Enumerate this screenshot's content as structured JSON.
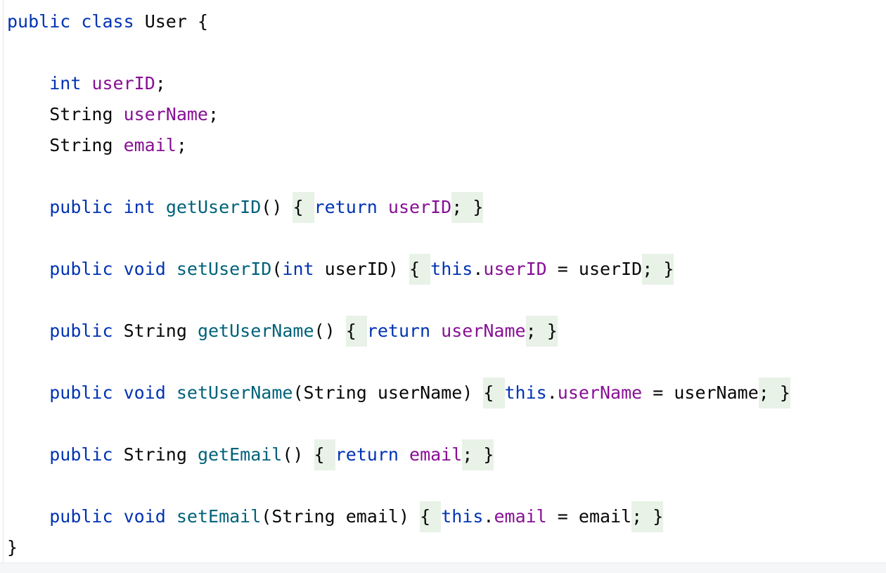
{
  "editor": {
    "lines": [
      {
        "tokens": [
          {
            "t": "public",
            "c": "kw"
          },
          {
            "t": " "
          },
          {
            "t": "class",
            "c": "kw"
          },
          {
            "t": " User {"
          }
        ]
      },
      {
        "tokens": []
      },
      {
        "tokens": [
          {
            "t": "    "
          },
          {
            "t": "int",
            "c": "kw"
          },
          {
            "t": " "
          },
          {
            "t": "userID",
            "c": "fld"
          },
          {
            "t": ";"
          }
        ]
      },
      {
        "tokens": [
          {
            "t": "    String "
          },
          {
            "t": "userName",
            "c": "fld"
          },
          {
            "t": ";"
          }
        ]
      },
      {
        "tokens": [
          {
            "t": "    String "
          },
          {
            "t": "email",
            "c": "fld"
          },
          {
            "t": ";"
          }
        ]
      },
      {
        "tokens": []
      },
      {
        "tokens": [
          {
            "t": "    "
          },
          {
            "t": "public",
            "c": "kw"
          },
          {
            "t": " "
          },
          {
            "t": "int",
            "c": "kw"
          },
          {
            "t": " "
          },
          {
            "t": "getUserID",
            "c": "fn"
          },
          {
            "t": "() "
          },
          {
            "t": "{ ",
            "h": true
          },
          {
            "t": "return",
            "c": "kw"
          },
          {
            "t": " "
          },
          {
            "t": "userID",
            "c": "fld"
          },
          {
            "t": "; ",
            "h": true
          },
          {
            "t": "}",
            "h": true
          }
        ]
      },
      {
        "tokens": []
      },
      {
        "tokens": [
          {
            "t": "    "
          },
          {
            "t": "public",
            "c": "kw"
          },
          {
            "t": " "
          },
          {
            "t": "void",
            "c": "kw"
          },
          {
            "t": " "
          },
          {
            "t": "setUserID",
            "c": "fn"
          },
          {
            "t": "("
          },
          {
            "t": "int",
            "c": "kw"
          },
          {
            "t": " userID) "
          },
          {
            "t": "{ ",
            "h": true
          },
          {
            "t": "this",
            "c": "kw"
          },
          {
            "t": "."
          },
          {
            "t": "userID",
            "c": "fld"
          },
          {
            "t": " = userID"
          },
          {
            "t": "; ",
            "h": true
          },
          {
            "t": "}",
            "h": true
          }
        ]
      },
      {
        "tokens": []
      },
      {
        "tokens": [
          {
            "t": "    "
          },
          {
            "t": "public",
            "c": "kw"
          },
          {
            "t": " String "
          },
          {
            "t": "getUserName",
            "c": "fn"
          },
          {
            "t": "() "
          },
          {
            "t": "{ ",
            "h": true
          },
          {
            "t": "return",
            "c": "kw"
          },
          {
            "t": " "
          },
          {
            "t": "userName",
            "c": "fld"
          },
          {
            "t": "; ",
            "h": true
          },
          {
            "t": "}",
            "h": true
          }
        ]
      },
      {
        "tokens": []
      },
      {
        "tokens": [
          {
            "t": "    "
          },
          {
            "t": "public",
            "c": "kw"
          },
          {
            "t": " "
          },
          {
            "t": "void",
            "c": "kw"
          },
          {
            "t": " "
          },
          {
            "t": "setUserName",
            "c": "fn"
          },
          {
            "t": "(String userName) "
          },
          {
            "t": "{ ",
            "h": true
          },
          {
            "t": "this",
            "c": "kw"
          },
          {
            "t": "."
          },
          {
            "t": "userName",
            "c": "fld"
          },
          {
            "t": " = userName"
          },
          {
            "t": "; ",
            "h": true
          },
          {
            "t": "}",
            "h": true
          }
        ]
      },
      {
        "tokens": []
      },
      {
        "tokens": [
          {
            "t": "    "
          },
          {
            "t": "public",
            "c": "kw"
          },
          {
            "t": " String "
          },
          {
            "t": "getEmail",
            "c": "fn"
          },
          {
            "t": "() "
          },
          {
            "t": "{ ",
            "h": true
          },
          {
            "t": "return",
            "c": "kw"
          },
          {
            "t": " "
          },
          {
            "t": "email",
            "c": "fld"
          },
          {
            "t": "; ",
            "h": true
          },
          {
            "t": "}",
            "h": true
          }
        ]
      },
      {
        "tokens": []
      },
      {
        "tokens": [
          {
            "t": "    "
          },
          {
            "t": "public",
            "c": "kw"
          },
          {
            "t": " "
          },
          {
            "t": "void",
            "c": "kw"
          },
          {
            "t": " "
          },
          {
            "t": "setEmail",
            "c": "fn"
          },
          {
            "t": "(String email) "
          },
          {
            "t": "{ ",
            "h": true
          },
          {
            "t": "this",
            "c": "kw"
          },
          {
            "t": "."
          },
          {
            "t": "email",
            "c": "fld"
          },
          {
            "t": " = email"
          },
          {
            "t": "; ",
            "h": true
          },
          {
            "t": "}",
            "h": true
          }
        ]
      },
      {
        "tokens": [
          {
            "t": "}"
          }
        ]
      }
    ]
  },
  "colors": {
    "keyword": "#0033b3",
    "field": "#871094",
    "method": "#00627a",
    "text": "#080808",
    "brace_highlight": "#e8f2e7"
  }
}
